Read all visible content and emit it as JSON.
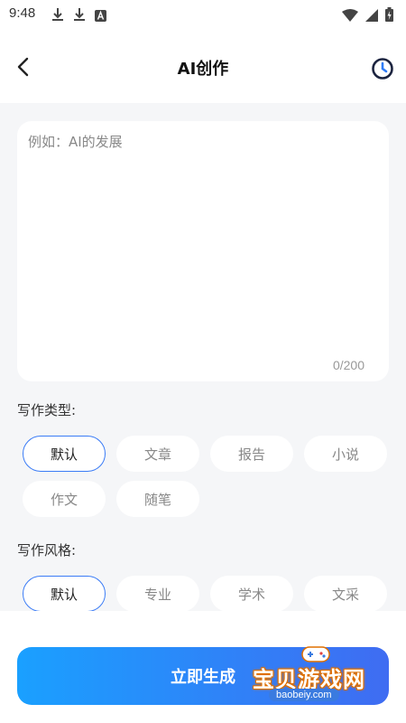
{
  "status_bar": {
    "time": "9:48",
    "left_icons": [
      "download-icon",
      "download-icon",
      "a-square-icon"
    ],
    "right_icons": [
      "wifi-icon",
      "signal-icon",
      "battery-charging-icon"
    ]
  },
  "nav": {
    "title": "AI创作",
    "back_icon": "chevron-left-icon",
    "history_icon": "clock-icon"
  },
  "input": {
    "value": "",
    "placeholder": "例如：AI的发展",
    "count": "0/200"
  },
  "writing_type": {
    "label": "写作类型:",
    "options": [
      "默认",
      "文章",
      "报告",
      "小说",
      "作文",
      "随笔"
    ],
    "selected": "默认"
  },
  "writing_style": {
    "label": "写作风格:",
    "options": [
      "默认",
      "专业",
      "学术",
      "文采"
    ],
    "selected": "默认"
  },
  "generate_button": "立即生成",
  "watermark": {
    "text": "宝贝游戏网",
    "domain": "baobeiy.com"
  },
  "colors": {
    "accent": "#3b7cf6",
    "button_start": "#1aa0ff",
    "button_end": "#3f6cf2",
    "background": "#f5f6f8"
  }
}
